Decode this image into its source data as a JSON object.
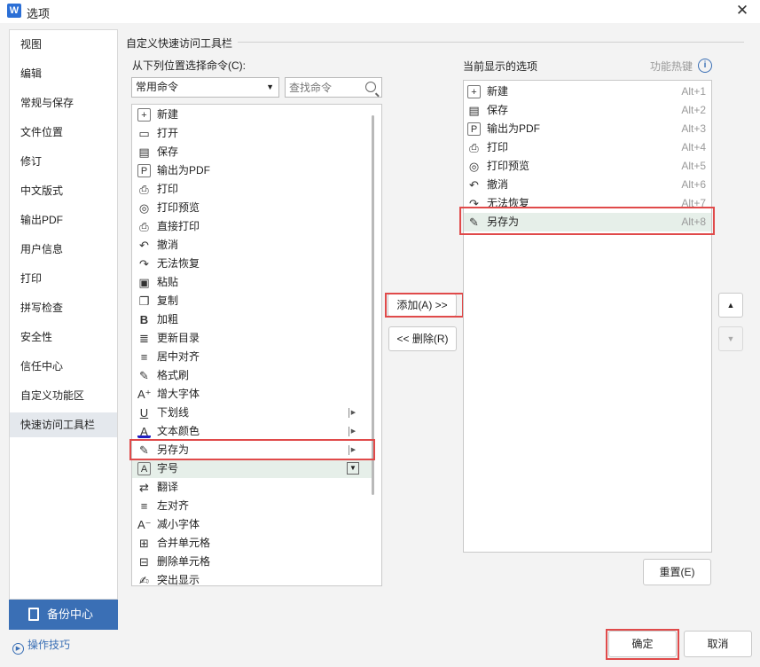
{
  "window": {
    "title": "选项",
    "app_icon_letter": "W"
  },
  "sidebar": {
    "items": [
      "视图",
      "编辑",
      "常规与保存",
      "文件位置",
      "修订",
      "中文版式",
      "输出PDF",
      "用户信息",
      "打印",
      "拼写检查",
      "安全性",
      "信任中心",
      "自定义功能区",
      "快速访问工具栏"
    ],
    "active": "快速访问工具栏",
    "backup_label": "备份中心",
    "tips_label": "操作技巧"
  },
  "section": {
    "title": "自定义快速访问工具栏"
  },
  "left_panel": {
    "label": "从下列位置选择命令(C):",
    "dropdown_value": "常用命令",
    "search_placeholder": "查找命令",
    "commands": [
      {
        "icon": "+",
        "label": "新建"
      },
      {
        "icon": "▭",
        "label": "打开"
      },
      {
        "icon": "▤",
        "label": "保存"
      },
      {
        "icon": "P",
        "label": "输出为PDF"
      },
      {
        "icon": "⎙",
        "label": "打印"
      },
      {
        "icon": "◎",
        "label": "打印预览"
      },
      {
        "icon": "⎙",
        "label": "直接打印"
      },
      {
        "icon": "↶",
        "label": "撤消"
      },
      {
        "icon": "↷",
        "label": "无法恢复"
      },
      {
        "icon": "▣",
        "label": "粘贴"
      },
      {
        "icon": "❐",
        "label": "复制"
      },
      {
        "icon": "B",
        "label": "加粗"
      },
      {
        "icon": "≣",
        "label": "更新目录"
      },
      {
        "icon": "≡",
        "label": "居中对齐"
      },
      {
        "icon": "✎",
        "label": "格式刷"
      },
      {
        "icon": "A⁺",
        "label": "增大字体"
      },
      {
        "icon": "U",
        "label": "下划线"
      },
      {
        "icon": "A",
        "label": "文本颜色"
      },
      {
        "icon": "✎",
        "label": "另存为"
      },
      {
        "icon": "A",
        "label": "字号"
      },
      {
        "icon": "⇄",
        "label": "翻译"
      },
      {
        "icon": "≡",
        "label": "左对齐"
      },
      {
        "icon": "A⁻",
        "label": "减小字体"
      },
      {
        "icon": "⊞",
        "label": "合并单元格"
      },
      {
        "icon": "⊟",
        "label": "删除单元格"
      },
      {
        "icon": "✍",
        "label": "突出显示"
      }
    ]
  },
  "middle": {
    "add_label": "添加(A) >>",
    "remove_label": "<< 删除(R)"
  },
  "right_panel": {
    "label": "当前显示的选项",
    "hotkey_label": "功能热键",
    "items": [
      {
        "icon": "+",
        "label": "新建",
        "key": "Alt+1"
      },
      {
        "icon": "▤",
        "label": "保存",
        "key": "Alt+2"
      },
      {
        "icon": "P",
        "label": "输出为PDF",
        "key": "Alt+3"
      },
      {
        "icon": "⎙",
        "label": "打印",
        "key": "Alt+4"
      },
      {
        "icon": "◎",
        "label": "打印预览",
        "key": "Alt+5"
      },
      {
        "icon": "↶",
        "label": "撤消",
        "key": "Alt+6"
      },
      {
        "icon": "↷",
        "label": "无法恢复",
        "key": "Alt+7"
      },
      {
        "icon": "✎",
        "label": "另存为",
        "key": "Alt+8"
      }
    ],
    "reset_label": "重置(E)"
  },
  "footer": {
    "ok_label": "确定",
    "cancel_label": "取消"
  },
  "colors": {
    "accent": "#3a6fb5",
    "highlight_red": "#e04a4a",
    "selected_row": "#e6efe9"
  }
}
